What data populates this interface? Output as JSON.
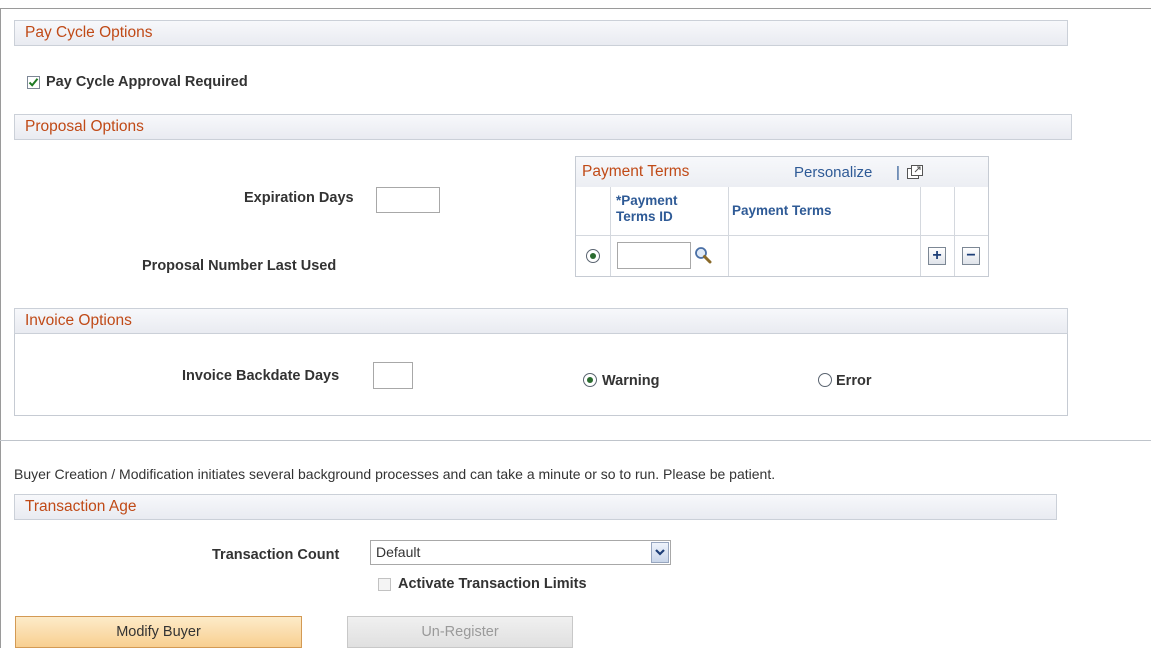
{
  "pay_cycle": {
    "header": "Pay Cycle Options",
    "approval_label": "Pay Cycle Approval Required",
    "approval_checked": true
  },
  "proposal": {
    "header": "Proposal Options",
    "expiration_label": "Expiration Days",
    "expiration_value": "",
    "last_used_label": "Proposal Number Last Used"
  },
  "payment_terms_grid": {
    "title": "Payment Terms",
    "personalize_label": "Personalize",
    "separator": "|",
    "columns": [
      "*Payment Terms ID",
      "Payment Terms"
    ],
    "rows": [
      {
        "terms_id": "",
        "terms": "",
        "selected": true
      }
    ],
    "add_label": "+",
    "remove_label": "−",
    "icons": [
      "new-window-icon",
      "lookup-magnifier-icon"
    ]
  },
  "invoice": {
    "header": "Invoice Options",
    "backdate_label": "Invoice Backdate Days",
    "backdate_value": "",
    "warning_label": "Warning",
    "error_label": "Error",
    "selected_option": "Warning"
  },
  "notice_text": "Buyer Creation / Modification initiates several background processes and can take a minute or so to run. Please be patient.",
  "transaction_age": {
    "header": "Transaction Age",
    "count_label": "Transaction Count",
    "count_value": "Default",
    "activate_limits_label": "Activate Transaction Limits",
    "activate_limits_checked": false
  },
  "buttons": {
    "modify_buyer": "Modify Buyer",
    "unregister": "Un-Register"
  },
  "colors": {
    "section_header_text": "#c04a17",
    "link": "#2e5a96",
    "primary_button": "#f8cf90"
  }
}
